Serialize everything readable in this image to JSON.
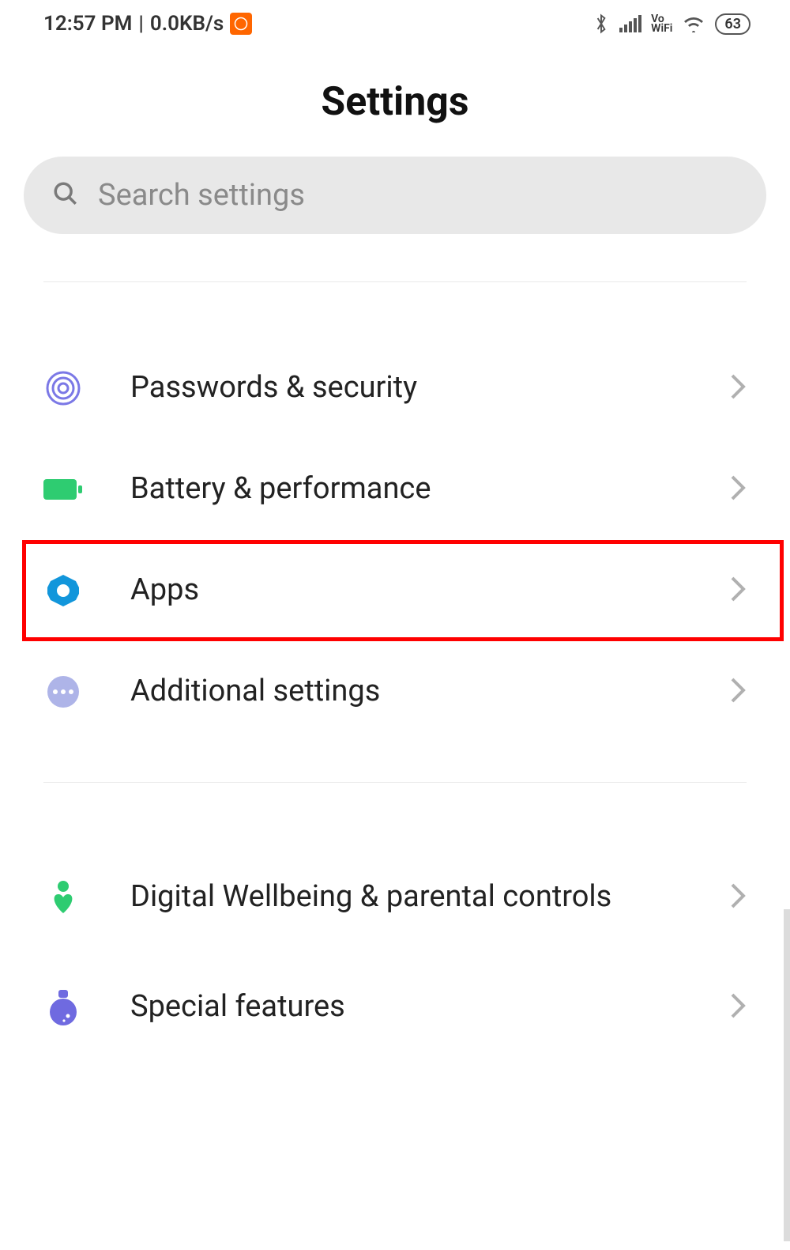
{
  "status_bar": {
    "time": "12:57 PM",
    "separator": "|",
    "net_speed": "0.0KB/s",
    "battery_level": "63",
    "vowifi_top": "Vo",
    "vowifi_bottom": "WiFi"
  },
  "page": {
    "title": "Settings"
  },
  "search": {
    "placeholder": "Search settings"
  },
  "items": {
    "passwords": {
      "label": "Passwords & security"
    },
    "battery": {
      "label": "Battery & performance"
    },
    "apps": {
      "label": "Apps"
    },
    "additional": {
      "label": "Additional settings"
    },
    "wellbeing": {
      "label": "Digital Wellbeing & parental controls"
    },
    "special": {
      "label": "Special features"
    }
  }
}
